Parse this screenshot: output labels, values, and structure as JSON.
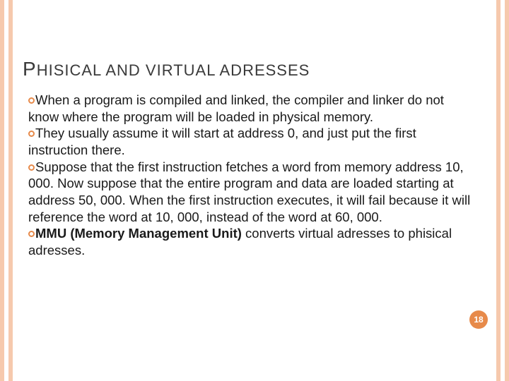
{
  "title": "PHISICAL AND VIRTUAL ADRESSES",
  "bullets": [
    {
      "lead": "When",
      "rest": " a program is compiled and linked, the compiler and linker do not know where the program will be loaded in physical memory."
    },
    {
      "lead": "They",
      "rest": " usually assume it will start at address 0, and just put the first instruction there."
    },
    {
      "lead": "Suppose",
      "rest": " that the first instruction fetches a word from memory address 10, 000. Now suppose that the entire program and data are loaded starting at address 50, 000. When the first instruction executes, it will fail because it will reference the word at 10, 000, instead of the word at 60, 000."
    },
    {
      "lead": "MMU (Memory Management Unit)",
      "rest": " converts virtual adresses to phisical adresses.",
      "lead_bold": true
    }
  ],
  "page_number": "18",
  "colors": {
    "accent": "#e78a4a",
    "stripe": "#f6c9ad"
  }
}
